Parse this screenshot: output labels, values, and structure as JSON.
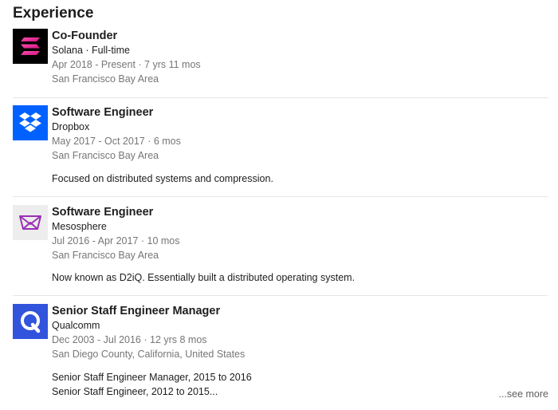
{
  "section": {
    "title": "Experience"
  },
  "experiences": [
    {
      "role": "Co-Founder",
      "company": "Solana · Full-time",
      "dates": "Apr 2018 - Present · 7 yrs 11 mos",
      "location": "San Francisco Bay Area",
      "logo_icon": "solana-logo-icon",
      "logo_bg": "#000000"
    },
    {
      "role": "Software Engineer",
      "company": "Dropbox",
      "dates": "May 2017 - Oct 2017 · 6 mos",
      "location": "San Francisco Bay Area",
      "description": "Focused on distributed systems and compression.",
      "logo_icon": "dropbox-logo-icon",
      "logo_bg": "#0061FF"
    },
    {
      "role": "Software Engineer",
      "company": "Mesosphere",
      "dates": "Jul 2016 - Apr 2017 · 10 mos",
      "location": "San Francisco Bay Area",
      "description": "Now known as D2iQ. Essentially built a distributed operating system.",
      "logo_icon": "mesosphere-logo-icon",
      "logo_bg": "#EDEDED"
    },
    {
      "role": "Senior Staff Engineer Manager",
      "company": "Qualcomm",
      "dates": "Dec 2003 - Jul 2016 · 12 yrs 8 mos",
      "location": "San Diego County, California, United States",
      "description_lines": [
        "Senior Staff Engineer Manager, 2015 to 2016",
        "Senior Staff Engineer, 2012 to 2015..."
      ],
      "logo_icon": "qualcomm-logo-icon",
      "logo_bg": "#3253DC"
    }
  ],
  "see_more": {
    "label": "...see more"
  }
}
